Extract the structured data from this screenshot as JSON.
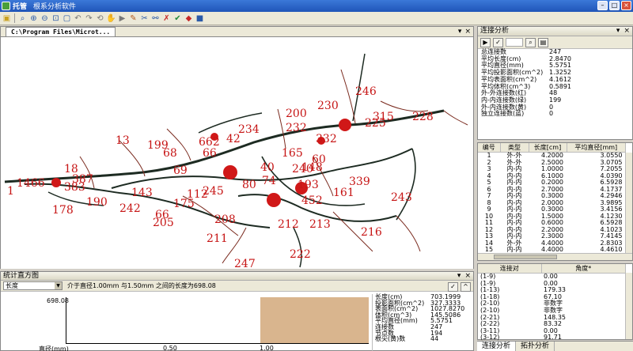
{
  "window": {
    "title": "托管",
    "subtitle": "根系分析软件"
  },
  "toolbar": {
    "icons": [
      "open-icon",
      "zoom-icon",
      "zoom-in-icon",
      "zoom-out-icon",
      "fit-icon",
      "select-icon",
      "undo-icon",
      "redo-icon",
      "refresh-icon",
      "pan-icon",
      "play-icon",
      "pencil-icon",
      "cut-icon",
      "link-icon",
      "split-icon",
      "color-icon",
      "measure-icon",
      "book-icon"
    ]
  },
  "document": {
    "tab_label": "C:\\Program Files\\Microt...",
    "labels": [
      "1",
      "13",
      "18",
      "20",
      "23",
      "38",
      "40",
      "42",
      "60",
      "66",
      "68",
      "69",
      "74",
      "80",
      "112",
      "143",
      "148",
      "161",
      "165",
      "175",
      "178",
      "190",
      "193",
      "199",
      "200",
      "205",
      "208",
      "211",
      "212",
      "213",
      "216",
      "222",
      "225",
      "228",
      "230",
      "232",
      "234",
      "240",
      "242",
      "243",
      "245",
      "246",
      "247",
      "315",
      "332",
      "339",
      "383",
      "387",
      "452",
      "662",
      "1466"
    ]
  },
  "connection": {
    "title": "连接分析",
    "rows": [
      {
        "k": "总连接数",
        "v": "247"
      },
      {
        "k": "平均长度(cm)",
        "v": "2.8470"
      },
      {
        "k": "平均直径(mm)",
        "v": "5.5751"
      },
      {
        "k": "平均投影面积(cm^2)",
        "v": "1.3252"
      },
      {
        "k": "平均表面积(cm^2)",
        "v": "4.1612"
      },
      {
        "k": "平均体积(cm^3)",
        "v": "0.5891"
      },
      {
        "k": "外-外连接数(红)",
        "v": "48"
      },
      {
        "k": "内-内连接数(绿)",
        "v": "199"
      },
      {
        "k": "外-内连接数(黄)",
        "v": "0"
      },
      {
        "k": "独立连接数(蓝)",
        "v": "0"
      }
    ]
  },
  "edges": {
    "headers": [
      "编号",
      "类型",
      "长度[cm]",
      "平均直径[mm]"
    ],
    "rows": [
      [
        "1",
        "外-外",
        "4.2000",
        "3.0550"
      ],
      [
        "2",
        "外-外",
        "2.5000",
        "3.0705"
      ],
      [
        "3",
        "内-内",
        "1.0000",
        "7.2055"
      ],
      [
        "4",
        "内-内",
        "6.1000",
        "4.0390"
      ],
      [
        "5",
        "内-内",
        "0.2000",
        "6.5928"
      ],
      [
        "6",
        "内-内",
        "2.7000",
        "4.1737"
      ],
      [
        "7",
        "内-内",
        "0.3000",
        "4.2946"
      ],
      [
        "8",
        "内-内",
        "2.0000",
        "3.9895"
      ],
      [
        "9",
        "内-内",
        "0.3000",
        "3.4156"
      ],
      [
        "10",
        "内-内",
        "1.5000",
        "4.1230"
      ],
      [
        "11",
        "内-内",
        "0.6000",
        "6.5928"
      ],
      [
        "12",
        "内-内",
        "2.2000",
        "4.1023"
      ],
      [
        "13",
        "内-内",
        "2.3000",
        "7.4145"
      ],
      [
        "14",
        "外-外",
        "4.4000",
        "2.8303"
      ],
      [
        "15",
        "内-内",
        "4.4000",
        "4.4610"
      ]
    ]
  },
  "angles": {
    "headers": [
      "连接对",
      "角度*"
    ],
    "rows": [
      [
        "(1-9)",
        "0.00"
      ],
      [
        "(1-9)",
        "0.00"
      ],
      [
        "(1-13)",
        "179.33"
      ],
      [
        "(1-18)",
        "67.10"
      ],
      [
        "(2-10)",
        "非数字"
      ],
      [
        "(2-10)",
        "非数字"
      ],
      [
        "(2-21)",
        "148.35"
      ],
      [
        "(2-22)",
        "83.32"
      ],
      [
        "(3-11)",
        "0.00"
      ],
      [
        "(3-12)",
        "91.71"
      ]
    ]
  },
  "bottom_tabs": [
    "连接分析",
    "拓扑分析"
  ],
  "histogram": {
    "title": "统计直方图",
    "select_value": "长度",
    "message": "介于直径1.00mm 与1.50mm 之间的长度为698.08",
    "y_max_label": "698.08",
    "x_label": "直径(mm)",
    "x_ticks": [
      "0.50",
      "1.00"
    ],
    "bins": [
      {
        "from": 1.0,
        "to": 1.5,
        "value": 698.08
      }
    ]
  },
  "stats": {
    "rows": [
      {
        "k": "长度(cm)",
        "v": "703.1999"
      },
      {
        "k": "投影面积(cm^2)",
        "v": "327.3333"
      },
      {
        "k": "表面积(cm^2)",
        "v": "1027.8270"
      },
      {
        "k": "体积(cm^3)",
        "v": "145.5086"
      },
      {
        "k": "平均直径(mm)",
        "v": "5.5751"
      },
      {
        "k": "连接数",
        "v": "247"
      },
      {
        "k": "节点数",
        "v": "194"
      },
      {
        "k": "根尖(黄)数",
        "v": "44"
      }
    ]
  },
  "colors": {
    "label_red": "#c61414",
    "root_dark": "#1d2b22",
    "root_brown": "#7a2a1e",
    "hist_bar": "#d9b58e",
    "titlebar_blue": "#245edb"
  }
}
